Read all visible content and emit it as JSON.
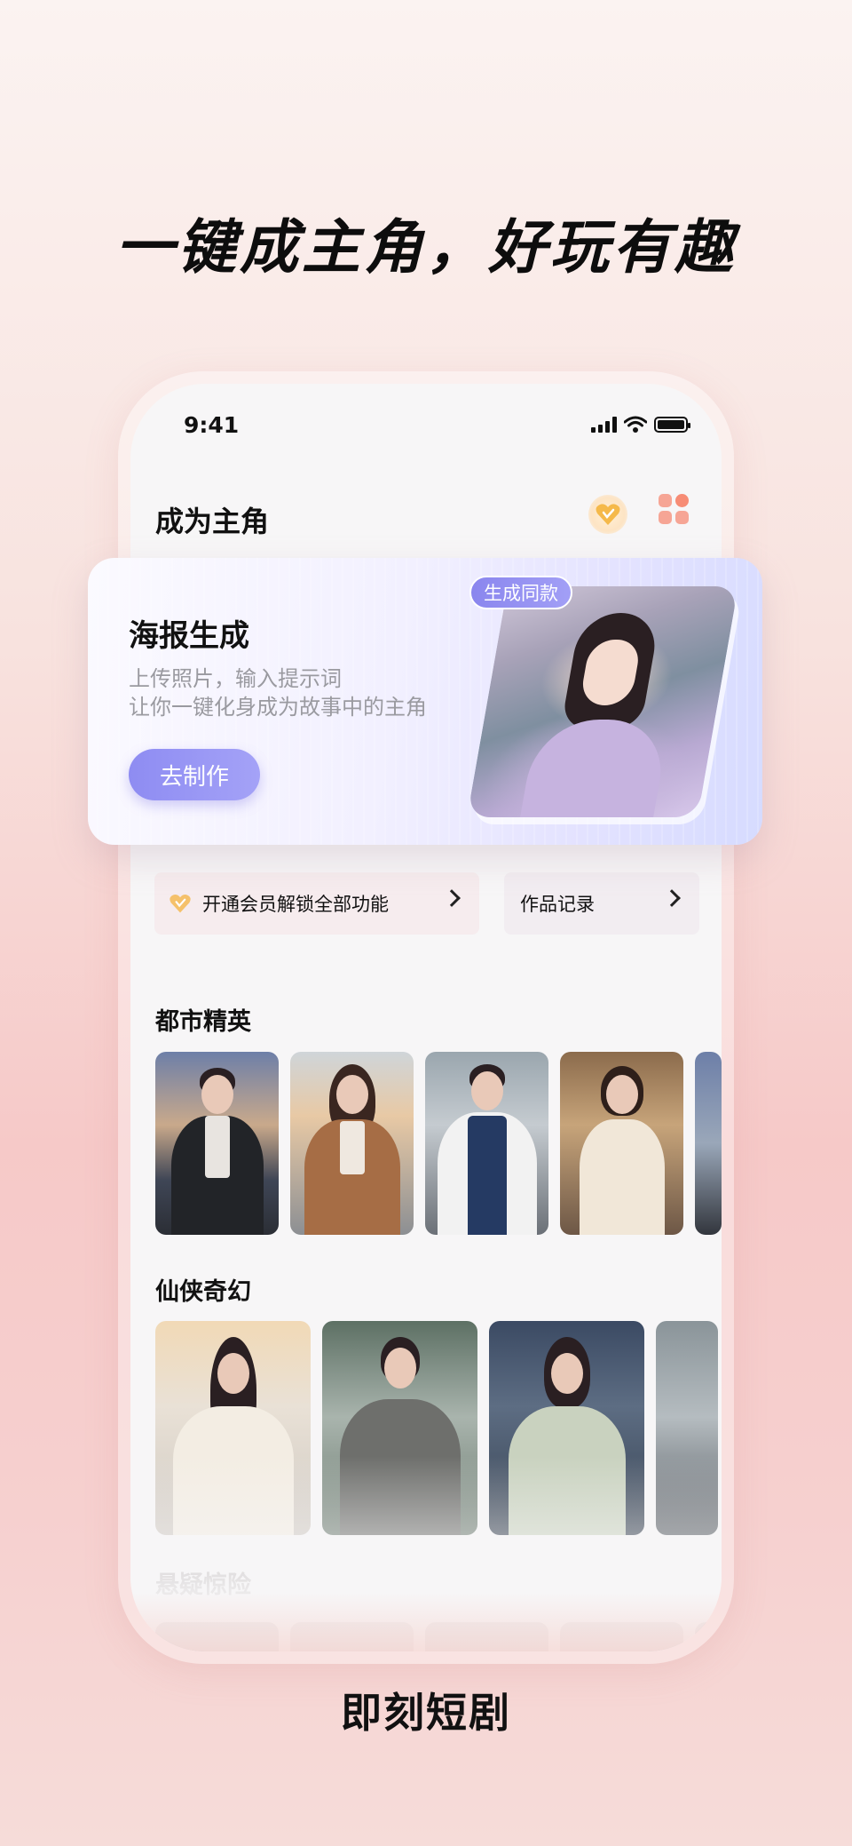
{
  "headline": "一键成主角，好玩有趣",
  "status_bar": {
    "time": "9:41"
  },
  "nav": {
    "title": "成为主角"
  },
  "banner": {
    "title": "海报生成",
    "desc_line1": "上传照片，输入提示词",
    "desc_line2": "让你一键化身成为故事中的主角",
    "button_label": "去制作",
    "tag_label": "生成同款"
  },
  "quick_actions": {
    "vip_label": "开通会员解锁全部功能",
    "works_label": "作品记录"
  },
  "sections": [
    {
      "title": "都市精英"
    },
    {
      "title": "仙侠奇幻"
    },
    {
      "title": "悬疑惊险"
    }
  ],
  "footer_label": "即刻短剧",
  "colors": {
    "accent_purple": "#8e8cf2",
    "accent_gold": "#f5b94a",
    "accent_coral": "#f78c75"
  }
}
